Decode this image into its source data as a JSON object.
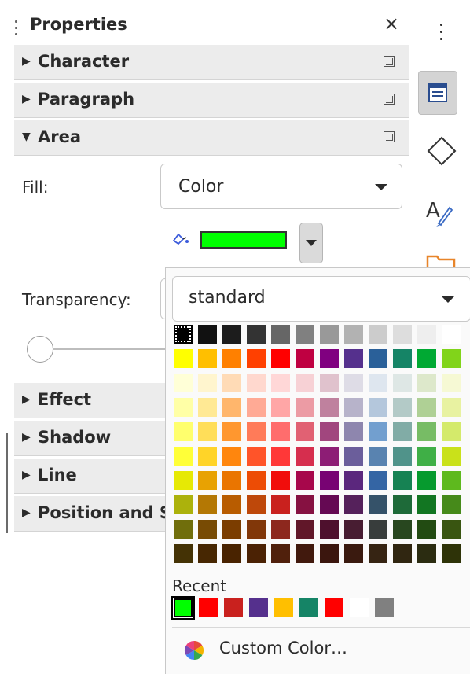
{
  "panel": {
    "title": "Properties",
    "close": "×"
  },
  "sections": {
    "character": "Character",
    "paragraph": "Paragraph",
    "area": "Area",
    "effect": "Effect",
    "shadow": "Shadow",
    "line": "Line",
    "position": "Position and Size"
  },
  "area": {
    "fill_label": "Fill:",
    "fill_value": "Color",
    "transparency_label": "Transparency:",
    "current_color": "#00ff00"
  },
  "palette": {
    "name": "standard",
    "rows": [
      [
        "#000000",
        "#111111",
        "#1c1c1c",
        "#333333",
        "#666666",
        "#808080",
        "#999999",
        "#b2b2b2",
        "#cccccc",
        "#dddddd",
        "#eeeeee",
        "#ffffff"
      ],
      [
        "#ffff00",
        "#ffbf00",
        "#ff8000",
        "#ff4000",
        "#ff0000",
        "#bf0041",
        "#800080",
        "#55308d",
        "#2a6099",
        "#158466",
        "#00a933",
        "#81d41a"
      ],
      [
        "#ffffd7",
        "#fff5ce",
        "#ffdbb6",
        "#ffd8ce",
        "#ffd7d7",
        "#f7d1d5",
        "#e0c2cd",
        "#dedce6",
        "#dee6ef",
        "#dee7e5",
        "#dde8cb",
        "#f6f9d4"
      ],
      [
        "#ffffa6",
        "#ffe994",
        "#ffb66c",
        "#ffaa95",
        "#ffa6a6",
        "#ec9ba4",
        "#bf819e",
        "#b7b3ca",
        "#b4c7dc",
        "#b3cac7",
        "#afd095",
        "#e8f2a1"
      ],
      [
        "#ffff6d",
        "#ffde59",
        "#ff972f",
        "#ff7b59",
        "#ff6d6d",
        "#e16173",
        "#a1467e",
        "#8e86ae",
        "#729fcf",
        "#81aca6",
        "#77bc65",
        "#d4ea6b"
      ],
      [
        "#ffff38",
        "#ffd428",
        "#ff860d",
        "#ff5429",
        "#ff3838",
        "#d62e4e",
        "#8d1d75",
        "#6b5e9b",
        "#5983b0",
        "#50938a",
        "#3faf46",
        "#c9e11a"
      ],
      [
        "#e6e905",
        "#e8a202",
        "#ea7500",
        "#ed4c05",
        "#f10d0c",
        "#a7074b",
        "#780373",
        "#5b277d",
        "#3465a4",
        "#168253",
        "#069a2e",
        "#5eb91e"
      ],
      [
        "#acb20c",
        "#b47804",
        "#b85c00",
        "#be480a",
        "#c9211e",
        "#861141",
        "#650953",
        "#55215b",
        "#355269",
        "#1e6a39",
        "#127622",
        "#468a1a"
      ],
      [
        "#706e0c",
        "#784b04",
        "#7b3d00",
        "#813709",
        "#8d281e",
        "#611729",
        "#4e102d",
        "#481d32",
        "#383d3c",
        "#28471f",
        "#224b12",
        "#395511"
      ],
      [
        "#443205",
        "#472702",
        "#492300",
        "#4b2204",
        "#50200c",
        "#41190d",
        "#3b160e",
        "#3a1a0f",
        "#362413",
        "#302611",
        "#2b2c11",
        "#2e3308"
      ]
    ]
  },
  "recent": {
    "label": "Recent",
    "colors": [
      "#00ff00",
      "#ff0000",
      "#c9211e",
      "#55308d",
      "#ffbf00",
      "#158466",
      "#ff0000",
      "#ffffff",
      "#808080"
    ]
  },
  "custom_color": {
    "label": "Custom Color…"
  }
}
